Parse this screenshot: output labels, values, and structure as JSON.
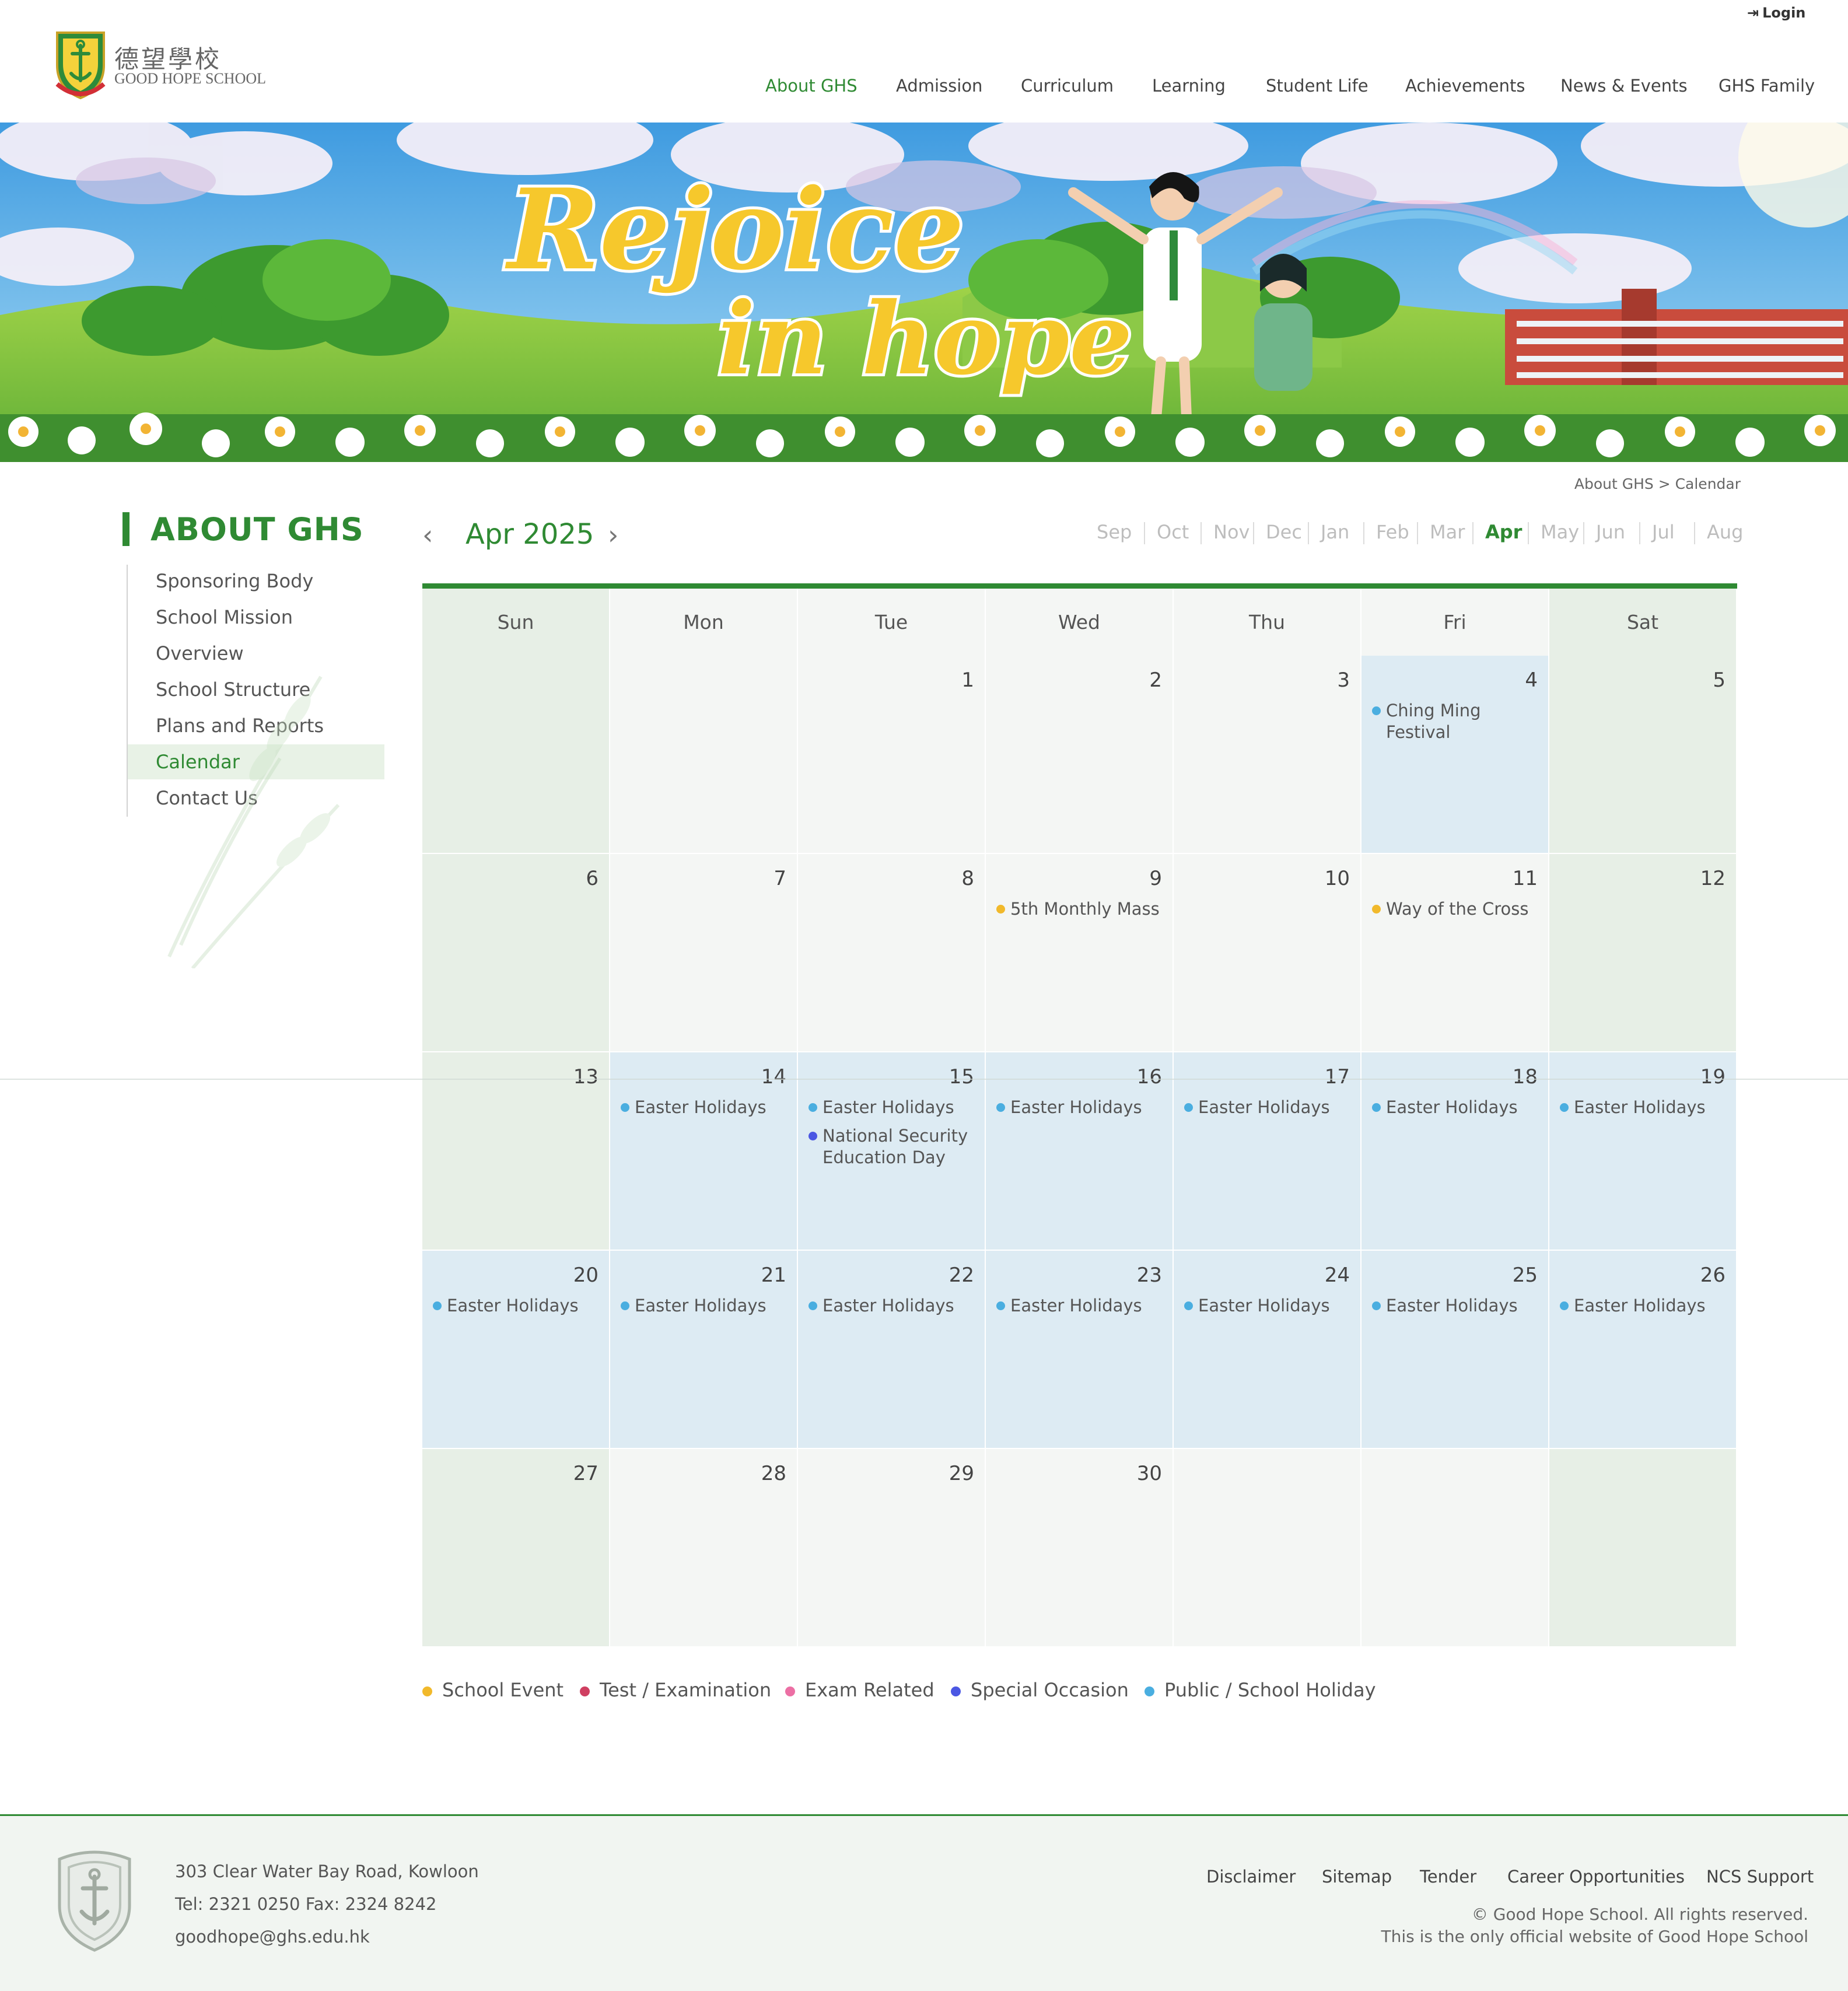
{
  "header": {
    "logo_cn": "德望學校",
    "logo_en": "GOOD HOPE SCHOOL",
    "login": "Login",
    "nav": [
      {
        "label": "About GHS",
        "active": true
      },
      {
        "label": "Admission"
      },
      {
        "label": "Curriculum"
      },
      {
        "label": "Learning"
      },
      {
        "label": "Student Life"
      },
      {
        "label": "Achievements"
      },
      {
        "label": "News & Events"
      },
      {
        "label": "GHS Family"
      }
    ]
  },
  "banner": {
    "line1": "Rejoice",
    "line2": "in hope"
  },
  "breadcrumb": "About GHS > Calendar",
  "sidebar": {
    "title": "ABOUT GHS",
    "items": [
      {
        "label": "Sponsoring Body"
      },
      {
        "label": "School Mission"
      },
      {
        "label": "Overview"
      },
      {
        "label": "School Structure"
      },
      {
        "label": "Plans and Reports"
      },
      {
        "label": "Calendar",
        "active": true
      },
      {
        "label": "Contact Us"
      }
    ]
  },
  "calendar": {
    "month_label": "Apr 2025",
    "months": [
      "Sep",
      "Oct",
      "Nov",
      "Dec",
      "Jan",
      "Feb",
      "Mar",
      "Apr",
      "May",
      "Jun",
      "Jul",
      "Aug"
    ],
    "active_month": "Apr",
    "weekdays": [
      "Sun",
      "Mon",
      "Tue",
      "Wed",
      "Thu",
      "Fri",
      "Sat"
    ],
    "weeks": [
      [
        {
          "day": ""
        },
        {
          "day": ""
        },
        {
          "day": "1"
        },
        {
          "day": "2"
        },
        {
          "day": "3"
        },
        {
          "day": "4",
          "holiday": true,
          "events": [
            {
              "label": "Ching Ming Festival",
              "type": "holiday"
            }
          ]
        },
        {
          "day": "5"
        }
      ],
      [
        {
          "day": "6"
        },
        {
          "day": "7"
        },
        {
          "day": "8"
        },
        {
          "day": "9",
          "events": [
            {
              "label": "5th Monthly Mass",
              "type": "school"
            }
          ]
        },
        {
          "day": "10"
        },
        {
          "day": "11",
          "events": [
            {
              "label": "Way of the Cross",
              "type": "school"
            }
          ]
        },
        {
          "day": "12"
        }
      ],
      [
        {
          "day": "13"
        },
        {
          "day": "14",
          "holiday": true,
          "events": [
            {
              "label": "Easter Holidays",
              "type": "holiday"
            }
          ]
        },
        {
          "day": "15",
          "holiday": true,
          "events": [
            {
              "label": "Easter Holidays",
              "type": "holiday"
            },
            {
              "label": "National Security Education Day",
              "type": "special"
            }
          ]
        },
        {
          "day": "16",
          "holiday": true,
          "events": [
            {
              "label": "Easter Holidays",
              "type": "holiday"
            }
          ]
        },
        {
          "day": "17",
          "holiday": true,
          "events": [
            {
              "label": "Easter Holidays",
              "type": "holiday"
            }
          ]
        },
        {
          "day": "18",
          "holiday": true,
          "events": [
            {
              "label": "Easter Holidays",
              "type": "holiday"
            }
          ]
        },
        {
          "day": "19",
          "holiday": true,
          "events": [
            {
              "label": "Easter Holidays",
              "type": "holiday"
            }
          ]
        }
      ],
      [
        {
          "day": "20",
          "holiday": true,
          "events": [
            {
              "label": "Easter Holidays",
              "type": "holiday"
            }
          ]
        },
        {
          "day": "21",
          "holiday": true,
          "events": [
            {
              "label": "Easter Holidays",
              "type": "holiday"
            }
          ]
        },
        {
          "day": "22",
          "holiday": true,
          "events": [
            {
              "label": "Easter Holidays",
              "type": "holiday"
            }
          ]
        },
        {
          "day": "23",
          "holiday": true,
          "events": [
            {
              "label": "Easter Holidays",
              "type": "holiday"
            }
          ]
        },
        {
          "day": "24",
          "holiday": true,
          "events": [
            {
              "label": "Easter Holidays",
              "type": "holiday"
            }
          ]
        },
        {
          "day": "25",
          "holiday": true,
          "events": [
            {
              "label": "Easter Holidays",
              "type": "holiday"
            }
          ]
        },
        {
          "day": "26",
          "holiday": true,
          "events": [
            {
              "label": "Easter Holidays",
              "type": "holiday"
            }
          ]
        }
      ],
      [
        {
          "day": "27"
        },
        {
          "day": "28"
        },
        {
          "day": "29"
        },
        {
          "day": "30"
        },
        {
          "day": ""
        },
        {
          "day": ""
        },
        {
          "day": ""
        }
      ]
    ],
    "legend": [
      {
        "label": "School Event",
        "type": "school"
      },
      {
        "label": "Test / Examination",
        "type": "test"
      },
      {
        "label": "Exam Related",
        "type": "exam"
      },
      {
        "label": "Special Occasion",
        "type": "special"
      },
      {
        "label": "Public / School Holiday",
        "type": "holiday"
      }
    ],
    "colors": {
      "school": "#f1b92b",
      "test": "#cf3f61",
      "exam": "#ec6fa4",
      "special": "#4b57e3",
      "holiday": "#4aaee0"
    }
  },
  "footer": {
    "address": "303 Clear Water Bay Road, Kowloon",
    "tel_fax": "Tel: 2321 0250   Fax: 2324 8242",
    "email": "goodhope@ghs.edu.hk",
    "links": [
      "Disclaimer",
      "Sitemap",
      "Tender",
      "Career Opportunities",
      "NCS Support"
    ],
    "copyright": "© Good Hope School. All rights reserved.",
    "official": "This is the only official website of Good Hope School"
  },
  "theme": {
    "accent": "#2f8a33"
  }
}
